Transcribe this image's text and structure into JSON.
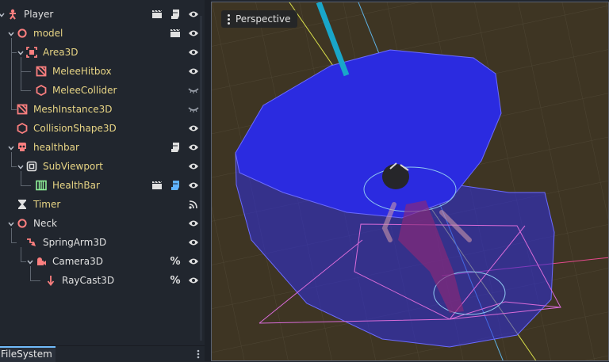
{
  "scene_tree": {
    "nodes": [
      {
        "name": "Player"
      },
      {
        "name": "model"
      },
      {
        "name": "Area3D"
      },
      {
        "name": "MeleeHitbox"
      },
      {
        "name": "MeleeCollider"
      },
      {
        "name": "MeshInstance3D"
      },
      {
        "name": "CollisionShape3D"
      },
      {
        "name": "healthbar"
      },
      {
        "name": "SubViewport"
      },
      {
        "name": "HealthBar"
      },
      {
        "name": "Timer"
      },
      {
        "name": "Neck"
      },
      {
        "name": "SpringArm3D"
      },
      {
        "name": "Camera3D"
      },
      {
        "name": "RayCast3D"
      }
    ],
    "unique_name_symbol": "%"
  },
  "filesystem": {
    "tab_label": "FileSystem"
  },
  "viewport": {
    "perspective_label": "Perspective"
  },
  "colors": {
    "node_red": "#fc7f7f",
    "node_yellow": "#e8d585",
    "script_blue": "#5fb2ff",
    "accent": "#70bafa",
    "capsule_blue": "#2a2ad9"
  }
}
